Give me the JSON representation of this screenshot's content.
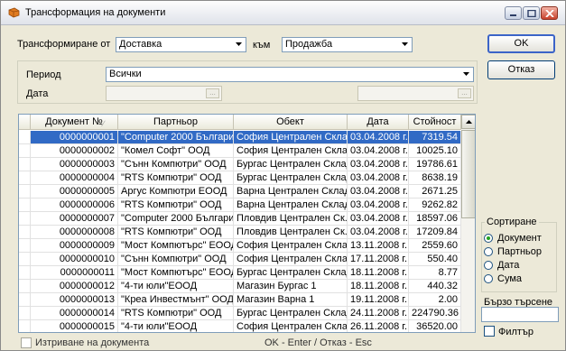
{
  "window": {
    "title": "Трансформация на документи"
  },
  "transform": {
    "from_label": "Трансформиране от",
    "from_value": "Доставка",
    "to_label": "към",
    "to_value": "Продажба"
  },
  "buttons": {
    "ok": "OK",
    "cancel": "Отказ"
  },
  "filters": {
    "period_label": "Период",
    "period_value": "Всички",
    "date_label": "Дата",
    "date_from": "",
    "date_to": ""
  },
  "grid": {
    "columns": [
      "Документ №",
      "Партньор",
      "Обект",
      "Дата",
      "Стойност"
    ],
    "rows": [
      [
        "0000000001",
        "\"Computer 2000 Българи...",
        "София Централен Склад",
        "03.04.2008 г.",
        "7319.54"
      ],
      [
        "0000000002",
        "\"Комел Софт\" ООД",
        "София Централен Склад",
        "03.04.2008 г.",
        "10025.10"
      ],
      [
        "0000000003",
        "\"Сънн Компютри\" ООД",
        "Бургас Централен Склад",
        "03.04.2008 г.",
        "19786.61"
      ],
      [
        "0000000004",
        "\"RTS Компютри\" ООД",
        "Бургас Централен Склад",
        "03.04.2008 г.",
        "8638.19"
      ],
      [
        "0000000005",
        "Аргус Компютри ЕООД",
        "Варна Централен Склад",
        "03.04.2008 г.",
        "2671.25"
      ],
      [
        "0000000006",
        "\"RTS Компютри\" ООД",
        "Варна Централен Склад",
        "03.04.2008 г.",
        "9262.82"
      ],
      [
        "0000000007",
        "\"Computer 2000 Българи...",
        "Пловдив Централен Ск...",
        "03.04.2008 г.",
        "18597.06"
      ],
      [
        "0000000008",
        "\"RTS Компютри\" ООД",
        "Пловдив Централен Ск...",
        "03.04.2008 г.",
        "17209.84"
      ],
      [
        "0000000009",
        "\"Мост Компютърс\" ЕООД",
        "София Централен Склад",
        "13.11.2008 г.",
        "2559.60"
      ],
      [
        "0000000010",
        "\"Сънн Компютри\" ООД",
        "София Централен Склад",
        "17.11.2008 г.",
        "550.40"
      ],
      [
        "0000000011",
        "\"Мост Компютърс\" ЕООД",
        "Бургас Централен Склад",
        "18.11.2008 г.",
        "8.77"
      ],
      [
        "0000000012",
        "\"4-ти юли\"ЕООД",
        "Магазин Бургас 1",
        "18.11.2008 г.",
        "440.32"
      ],
      [
        "0000000013",
        "\"Креа Инвестмънт\" ООД",
        "Магазин Варна 1",
        "19.11.2008 г.",
        "2.00"
      ],
      [
        "0000000014",
        "\"RTS Компютри\" ООД",
        "Бургас Централен Склад",
        "24.11.2008 г.",
        "224790.36"
      ],
      [
        "0000000015",
        "\"4-ти юли\"ЕООД",
        "София Централен Склад",
        "26.11.2008 г.",
        "36520.00"
      ]
    ]
  },
  "sort": {
    "title": "Сортиране",
    "options": [
      "Документ",
      "Партньор",
      "Дата",
      "Сума"
    ],
    "selected": "Документ"
  },
  "quick_search": {
    "label": "Бързо търсене",
    "value": ""
  },
  "filter_checkbox": {
    "label": "Филтър",
    "checked": false
  },
  "delete_checkbox": {
    "label": "Изтриване на документа",
    "checked": false
  },
  "status_hint": "OK - Enter / Отказ - Esc",
  "colors": {
    "selection": "#316ac5",
    "window_bg": "#ece9d8",
    "radio_dot": "#21a121"
  }
}
